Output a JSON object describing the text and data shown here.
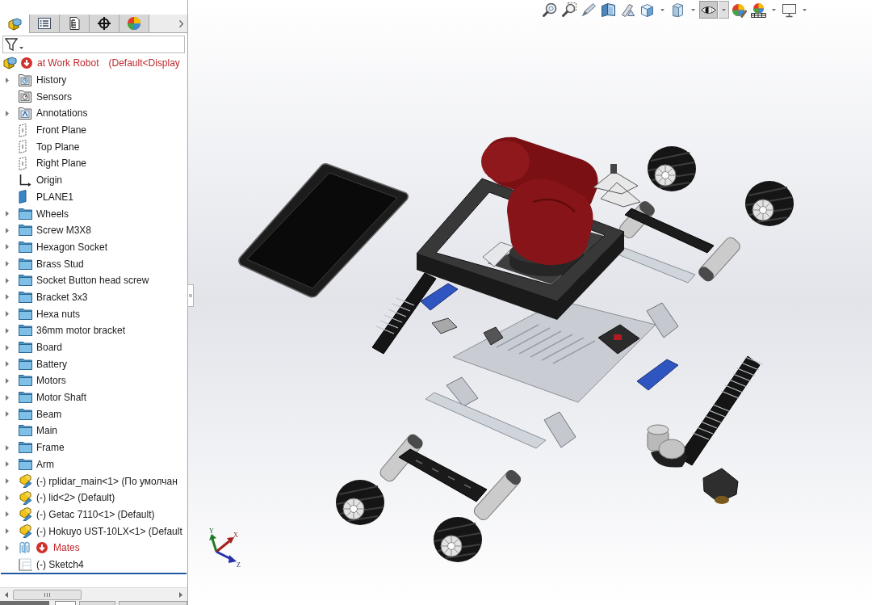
{
  "panel_tabs": [
    {
      "kind": "feature-tree",
      "selected": true
    },
    {
      "kind": "property-list",
      "selected": false
    },
    {
      "kind": "configurations",
      "selected": false
    },
    {
      "kind": "dimxpert",
      "selected": false
    },
    {
      "kind": "display-manager",
      "selected": false
    }
  ],
  "tree": {
    "root": {
      "name": "at Work Robot",
      "configuration": "(Default<Display",
      "error": true
    },
    "items": [
      {
        "label": "History",
        "kind": "history",
        "expandable": true,
        "error": false
      },
      {
        "label": "Sensors",
        "kind": "sensors",
        "expandable": false,
        "error": false
      },
      {
        "label": "Annotations",
        "kind": "annotations",
        "expandable": true,
        "error": false
      },
      {
        "label": "Front Plane",
        "kind": "plane",
        "expandable": false,
        "error": false
      },
      {
        "label": "Top Plane",
        "kind": "plane",
        "expandable": false,
        "error": false
      },
      {
        "label": "Right Plane",
        "kind": "plane",
        "expandable": false,
        "error": false
      },
      {
        "label": "Origin",
        "kind": "origin",
        "expandable": false,
        "error": false
      },
      {
        "label": "PLANE1",
        "kind": "ref-plane",
        "expandable": false,
        "error": false
      },
      {
        "label": "Wheels",
        "kind": "folder",
        "expandable": true,
        "error": false
      },
      {
        "label": "Screw M3X8",
        "kind": "folder",
        "expandable": true,
        "error": false
      },
      {
        "label": "Hexagon Socket",
        "kind": "folder",
        "expandable": true,
        "error": false
      },
      {
        "label": "Brass Stud",
        "kind": "folder",
        "expandable": true,
        "error": false
      },
      {
        "label": "Socket Button head screw",
        "kind": "folder",
        "expandable": true,
        "error": false
      },
      {
        "label": "Bracket 3x3",
        "kind": "folder",
        "expandable": true,
        "error": false
      },
      {
        "label": "Hexa nuts",
        "kind": "folder",
        "expandable": true,
        "error": false
      },
      {
        "label": "36mm motor bracket",
        "kind": "folder",
        "expandable": true,
        "error": false
      },
      {
        "label": "Board",
        "kind": "folder",
        "expandable": true,
        "error": false
      },
      {
        "label": "Battery",
        "kind": "folder",
        "expandable": true,
        "error": false
      },
      {
        "label": "Motors",
        "kind": "folder",
        "expandable": true,
        "error": false
      },
      {
        "label": "Motor Shaft",
        "kind": "folder",
        "expandable": true,
        "error": false
      },
      {
        "label": "Beam",
        "kind": "folder",
        "expandable": true,
        "error": false
      },
      {
        "label": "Main",
        "kind": "folder",
        "expandable": false,
        "error": false
      },
      {
        "label": "Frame",
        "kind": "folder",
        "expandable": true,
        "error": false
      },
      {
        "label": "Arm",
        "kind": "folder",
        "expandable": true,
        "error": false
      },
      {
        "label": "(-) rplidar_main<1> (По умолчан",
        "kind": "component",
        "expandable": true,
        "error": false
      },
      {
        "label": "(-) lid<2> (Default)",
        "kind": "component",
        "expandable": true,
        "error": false
      },
      {
        "label": "(-) Getac 7110<1> (Default)",
        "kind": "component",
        "expandable": true,
        "error": false
      },
      {
        "label": "(-) Hokuyo UST-10LX<1> (Default",
        "kind": "component",
        "expandable": true,
        "error": false
      },
      {
        "label": "Mates",
        "kind": "mates",
        "expandable": true,
        "error": true
      },
      {
        "label": "(-) Sketch4",
        "kind": "sketch",
        "expandable": false,
        "error": false
      }
    ]
  },
  "view_toolbar": [
    {
      "kind": "zoom-to-fit",
      "pressed": false,
      "dropdown": false
    },
    {
      "kind": "zoom-to-area",
      "pressed": false,
      "dropdown": false
    },
    {
      "kind": "previous-view",
      "pressed": false,
      "dropdown": false
    },
    {
      "kind": "section-view",
      "pressed": false,
      "dropdown": false
    },
    {
      "kind": "dynamic-annotation",
      "pressed": false,
      "dropdown": false
    },
    {
      "kind": "view-orientation",
      "pressed": false,
      "dropdown": true
    },
    {
      "kind": "display-style",
      "pressed": false,
      "dropdown": true
    },
    {
      "kind": "hide-show",
      "pressed": true,
      "dropdown": true
    },
    {
      "kind": "edit-appearance",
      "pressed": false,
      "dropdown": false
    },
    {
      "kind": "apply-scene",
      "pressed": false,
      "dropdown": true
    },
    {
      "kind": "view-settings",
      "pressed": false,
      "dropdown": true
    }
  ],
  "triad": {
    "x": "X",
    "y": "Y",
    "z": "Z"
  },
  "sheet_tabs": [
    {
      "selected": true
    },
    {
      "selected": false
    },
    {
      "selected": false
    }
  ]
}
